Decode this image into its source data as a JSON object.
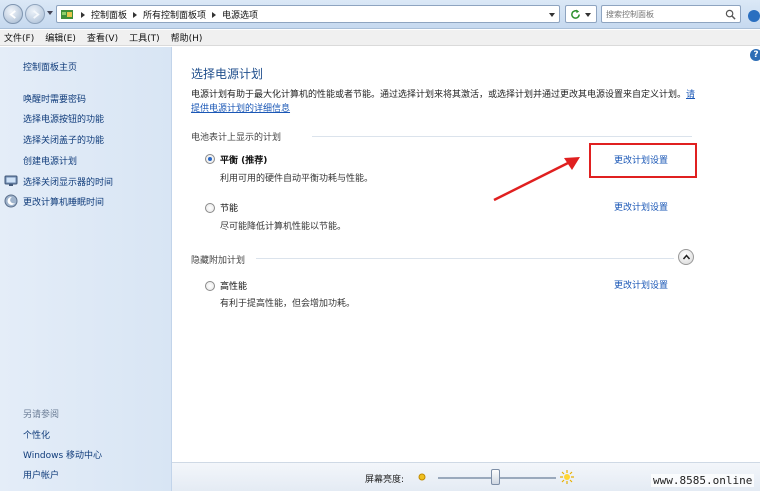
{
  "address_bar": {
    "breadcrumbs": [
      "控制面板",
      "所有控制面板项",
      "电源选项"
    ],
    "search_placeholder": "搜索控制面板"
  },
  "menu": [
    "文件(F)",
    "编辑(E)",
    "查看(V)",
    "工具(T)",
    "帮助(H)"
  ],
  "sidebar": {
    "home": "控制面板主页",
    "links": [
      "唤醒时需要密码",
      "选择电源按钮的功能",
      "选择关闭盖子的功能",
      "创建电源计划",
      "选择关闭显示器的时间",
      "更改计算机睡眠时间"
    ],
    "see_also_heading": "另请参阅",
    "see_also": [
      "个性化",
      "Windows 移动中心",
      "用户帐户"
    ]
  },
  "main": {
    "title": "选择电源计划",
    "description": "电源计划有助于最大化计算机的性能或者节能。通过选择计划来将其激活，或选择计划并通过更改其电源设置来自定义计划。",
    "description_link": "请提供电源计划的详细信息",
    "group_shown": "电池表计上显示的计划",
    "group_hidden": "隐藏附加计划",
    "plans": [
      {
        "name": "平衡 (推荐)",
        "desc": "利用可用的硬件自动平衡功耗与性能。",
        "link": "更改计划设置",
        "selected": true
      },
      {
        "name": "节能",
        "desc": "尽可能降低计算机性能以节能。",
        "link": "更改计划设置",
        "selected": false
      },
      {
        "name": "高性能",
        "desc": "有利于提高性能，但会增加功耗。",
        "link": "更改计划设置",
        "selected": false
      }
    ]
  },
  "bottom": {
    "brightness_label": "屏幕亮度:",
    "brightness_level": 0.48
  },
  "watermark": "www.8585.online",
  "colors": {
    "link": "#1a57b6",
    "title": "#1f4e8c",
    "highlight": "#e02020"
  }
}
